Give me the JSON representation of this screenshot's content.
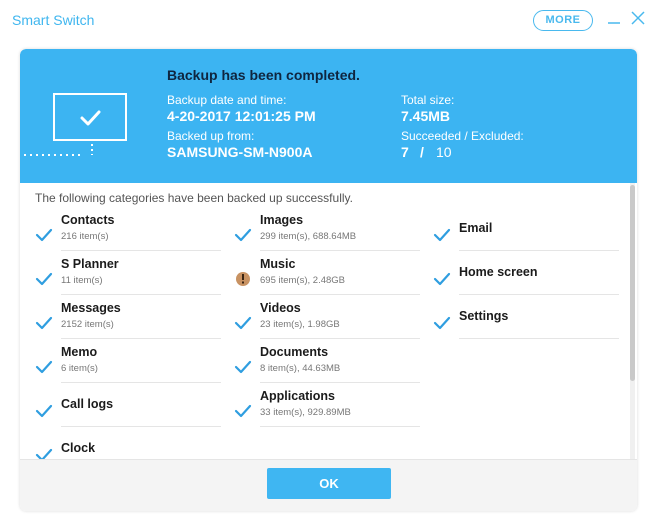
{
  "window": {
    "title": "Smart Switch",
    "more_label": "MORE"
  },
  "header": {
    "title": "Backup has been completed.",
    "date_label": "Backup date and time:",
    "date_value": "4-20-2017 12:01:25 PM",
    "from_label": "Backed up from:",
    "from_value": "SAMSUNG-SM-N900A",
    "size_label": "Total size:",
    "size_value": "7.45MB",
    "result_label": "Succeeded / Excluded:",
    "succeeded": "7",
    "result_sep": "/",
    "excluded": "10"
  },
  "content": {
    "intro": "The following categories have been backed up successfully.",
    "categories": [
      {
        "name": "Contacts",
        "info": "216 item(s)",
        "status": "check"
      },
      {
        "name": "S Planner",
        "info": "11 item(s)",
        "status": "check"
      },
      {
        "name": "Messages",
        "info": "2152 item(s)",
        "status": "check"
      },
      {
        "name": "Memo",
        "info": "6 item(s)",
        "status": "check"
      },
      {
        "name": "Call logs",
        "info": "",
        "status": "check"
      },
      {
        "name": "Clock",
        "info": "",
        "status": "check"
      },
      {
        "name": "Images",
        "info": "299 item(s), 688.64MB",
        "status": "check"
      },
      {
        "name": "Music",
        "info": "695 item(s), 2.48GB",
        "status": "warning"
      },
      {
        "name": "Videos",
        "info": "23 item(s), 1.98GB",
        "status": "check"
      },
      {
        "name": "Documents",
        "info": "8 item(s), 44.63MB",
        "status": "check"
      },
      {
        "name": "Applications",
        "info": "33 item(s), 929.89MB",
        "status": "check"
      },
      {
        "name": "Email",
        "info": "",
        "status": "check"
      },
      {
        "name": "Home screen",
        "info": "",
        "status": "check"
      },
      {
        "name": "Settings",
        "info": "",
        "status": "check"
      }
    ]
  },
  "footer": {
    "ok_label": "OK"
  },
  "colors": {
    "accent": "#3cb4f2",
    "check": "#2f9ee0",
    "title_dark": "#0f2640"
  }
}
